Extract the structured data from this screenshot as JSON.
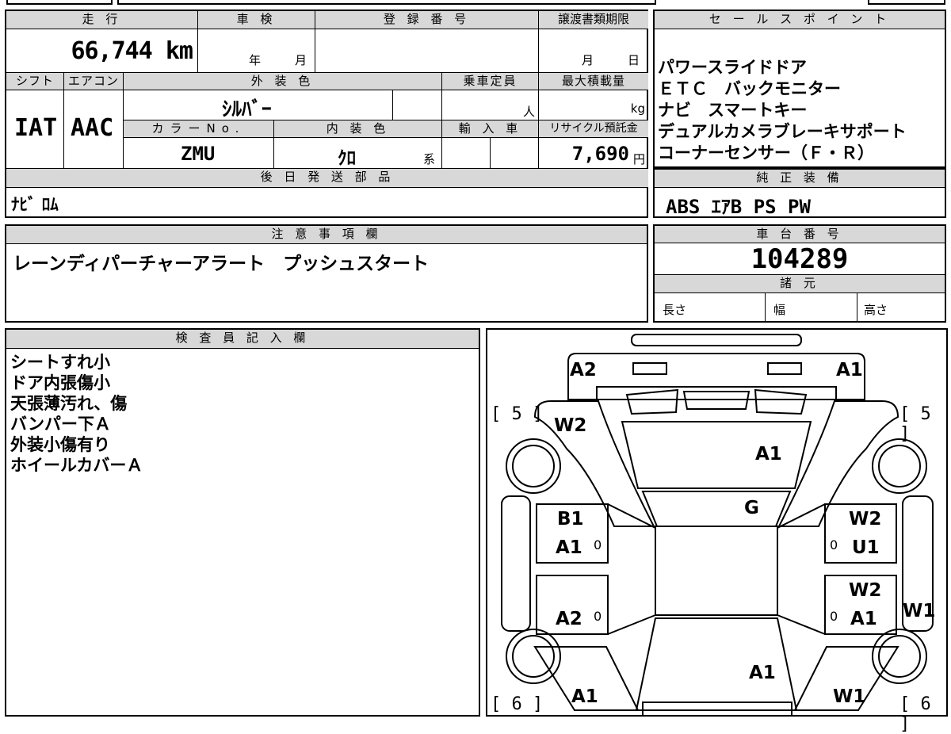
{
  "top_table": {
    "mileage_header": "走 行",
    "mileage_value": "66,744 km",
    "shaken_header": "車 検",
    "shaken_year": "年",
    "shaken_month": "月",
    "registration_header": "登 録 番 号",
    "transfer_header": "譲渡書類期限",
    "transfer_month": "月",
    "transfer_day": "日",
    "shift_header": "シフト",
    "shift_value": "IAT",
    "ac_header": "エアコン",
    "ac_value": "AAC",
    "exterior_header": "外 装 色",
    "exterior_value": "ｼﾙﾊﾞｰ",
    "capacity_header": "乗車定員",
    "capacity_unit": "人",
    "max_load_header": "最大積載量",
    "max_load_unit": "kg",
    "color_no_header": "カラーNo.",
    "color_no_value": "ZMU",
    "interior_header": "内 装 色",
    "interior_value": "ｸﾛ",
    "interior_suffix": "系",
    "import_header": "輸 入 車",
    "recycle_header": "リサイクル預託金",
    "recycle_value": "7,690",
    "recycle_unit": "円",
    "later_parts_header": "後 日 発 送 部 品",
    "later_parts_value": "ﾅﾋﾞ ﾛﾑ"
  },
  "sales_points": {
    "header": "セ ー ル ス ポ イ ン ト",
    "lines": [
      "パワースライドドア",
      "ＥＴＣ　バックモニター",
      "ナビ　スマートキー",
      "デュアルカメラブレーキサポート",
      "コーナーセンサー（Ｆ・Ｒ）"
    ]
  },
  "genuine_equipment": {
    "header": "純 正 装 備",
    "value": "ABS ｴｱB PS PW"
  },
  "notes": {
    "header": "注 意 事 項 欄",
    "value": "レーンディパーチャーアラート　プッシュスタート"
  },
  "chassis": {
    "header": "車 台 番 号",
    "value": "104289"
  },
  "specs": {
    "header": "諸 元",
    "length_label": "長さ",
    "width_label": "幅",
    "height_label": "高さ"
  },
  "inspector": {
    "header": "検 査 員 記 入 欄",
    "lines": [
      "シートすれ小",
      "ドア内張傷小",
      "天張薄汚れ、傷",
      "バンパー下Ａ",
      "外装小傷有り",
      "ホイールカバーＡ"
    ]
  },
  "diagram": {
    "labels": {
      "front_left": "A2",
      "front_right": "A1",
      "hood": "A1",
      "windshield": "G",
      "front_left_fender": "W2",
      "left_front_door_1": "B1",
      "left_front_door_2": "A1",
      "left_rear_door": "A2",
      "left_rear_quarter": "A1",
      "right_front_door_1": "W2",
      "right_front_door_2": "U1",
      "right_rear_door_1": "W2",
      "right_rear_door_2": "A1",
      "right_side_sill": "W1",
      "roof_rear": "A1",
      "right_rear_quarter": "W1",
      "marker_0": "0",
      "tire_front_left": "[ 5 ]",
      "tire_front_right": "[ 5 ]",
      "tire_rear_left": "[ 6 ]",
      "tire_rear_right": "[ 6 ]"
    }
  }
}
